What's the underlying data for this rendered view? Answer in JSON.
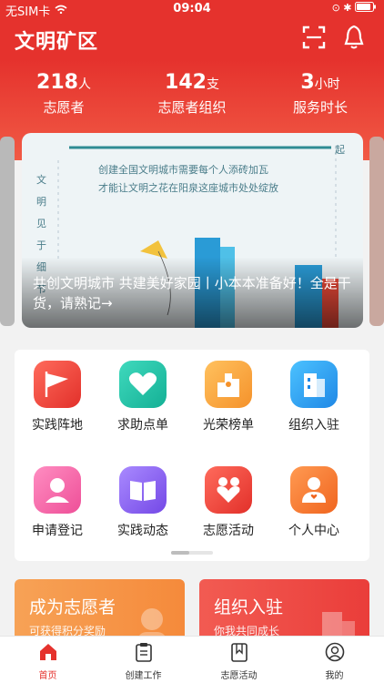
{
  "status_bar": {
    "carrier": "无SIM卡",
    "time": "09:04",
    "right_icons": [
      "wifi-icon",
      "lock-rotation-icon",
      "bluetooth-icon",
      "battery-icon"
    ]
  },
  "header": {
    "title": "文明矿区",
    "scan_icon": "scan-icon",
    "bell_icon": "bell-icon"
  },
  "stats": [
    {
      "number": "218",
      "unit": "人",
      "label": "志愿者"
    },
    {
      "number": "142",
      "unit": "支",
      "label": "志愿者组织"
    },
    {
      "number": "3",
      "unit": "小时",
      "label": "服务时长"
    }
  ],
  "banner": {
    "line1": "创建全国文明城市需要每个人添砖加瓦",
    "line2": "才能让文明之花在阳泉这座城市处处绽放",
    "vertical_text": "文明见于细节",
    "corner_text": "起",
    "caption": "共创文明城市 共建美好家园丨小本本准备好！全是干货，请熟记→"
  },
  "grid": {
    "items": [
      {
        "label": "实践阵地",
        "icon": "flag-icon",
        "color": "#f0453a"
      },
      {
        "label": "求助点单",
        "icon": "heart-icon",
        "color": "#22c3a6"
      },
      {
        "label": "光荣榜单",
        "icon": "honor-board-icon",
        "color": "#f7a23b"
      },
      {
        "label": "组织入驻",
        "icon": "building-icon",
        "color": "#2f9cf0"
      },
      {
        "label": "申请登记",
        "icon": "person-register-icon",
        "color": "#f264a4"
      },
      {
        "label": "实践动态",
        "icon": "book-icon",
        "color": "#8a5cf0"
      },
      {
        "label": "志愿活动",
        "icon": "volunteer-icon",
        "color": "#f0453a"
      },
      {
        "label": "个人中心",
        "icon": "user-icon",
        "color": "#f77a2b"
      }
    ]
  },
  "promos": [
    {
      "title": "成为志愿者",
      "subtitle": "可获得积分奖励",
      "color": "#f59a4a"
    },
    {
      "title": "组织入驻",
      "subtitle": "你我共同成长",
      "color": "#ef4f4f"
    }
  ],
  "tabbar": {
    "tabs": [
      {
        "label": "首页",
        "icon": "home-icon",
        "active": true
      },
      {
        "label": "创建工作",
        "icon": "clipboard-icon",
        "active": false
      },
      {
        "label": "志愿活动",
        "icon": "bookmark-icon",
        "active": false
      },
      {
        "label": "我的",
        "icon": "profile-icon",
        "active": false
      }
    ]
  },
  "colors": {
    "brand": "#e5322d",
    "tab_active": "#e5322d"
  }
}
